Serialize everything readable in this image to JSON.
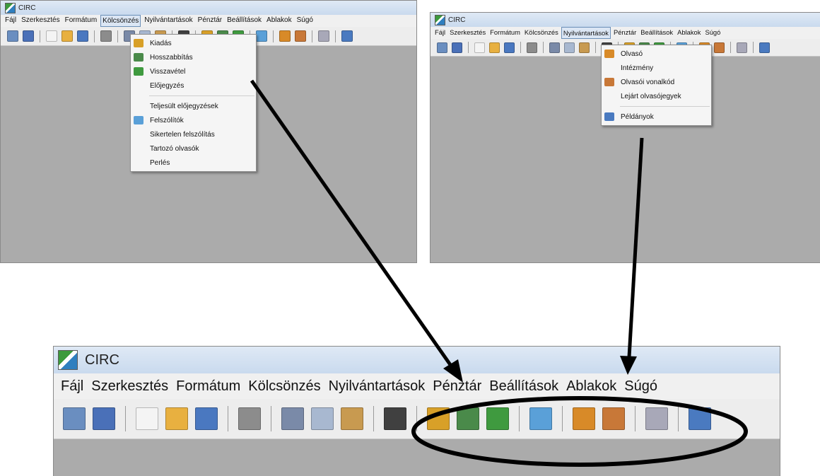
{
  "app_title": "CIRC",
  "menus": [
    "Fájl",
    "Szerkesztés",
    "Formátum",
    "Kölcsönzés",
    "Nyilvántartások",
    "Pénztár",
    "Beállítások",
    "Ablakok",
    "Súgó"
  ],
  "kolcsonzes_menu": {
    "items": [
      {
        "label": "Kiadás",
        "icon": "checkout-icon",
        "color": "#d8a028"
      },
      {
        "label": "Hosszabbítás",
        "icon": "renew-icon",
        "color": "#4a8a4a"
      },
      {
        "label": "Visszavétel",
        "icon": "return-icon",
        "color": "#3f9a3f"
      },
      {
        "label": "Előjegyzés",
        "icon": "",
        "color": ""
      },
      {
        "label": "Teljesült előjegyzések",
        "icon": "",
        "color": ""
      },
      {
        "label": "Felszólítók",
        "icon": "notice-icon",
        "color": "#5aa0d8"
      },
      {
        "label": "Sikertelen felszólítás",
        "icon": "",
        "color": ""
      },
      {
        "label": "Tartozó olvasók",
        "icon": "",
        "color": ""
      },
      {
        "label": "Perlés",
        "icon": "",
        "color": ""
      }
    ]
  },
  "nyilvantartasok_menu": {
    "items": [
      {
        "label": "Olvasó",
        "icon": "reader-icon",
        "color": "#d88a28"
      },
      {
        "label": "Intézmény",
        "icon": "",
        "color": ""
      },
      {
        "label": "Olvasói vonalkód",
        "icon": "barcode-reader-icon",
        "color": "#c87838"
      },
      {
        "label": "Lejárt olvasójegyek",
        "icon": "",
        "color": ""
      },
      {
        "label": "Példányok",
        "icon": "copies-icon",
        "color": "#4a7ac0"
      }
    ]
  },
  "toolbar_icons": [
    {
      "name": "preview-icon",
      "color": "#6a8ec0"
    },
    {
      "name": "edit-pen-icon",
      "color": "#4a70b8"
    },
    "sep",
    {
      "name": "new-document-icon",
      "color": "#f4f4f4"
    },
    {
      "name": "open-folder-icon",
      "color": "#e8b040"
    },
    {
      "name": "save-icon",
      "color": "#4a78c0"
    },
    "sep",
    {
      "name": "print-icon",
      "color": "#8c8c8c"
    },
    "sep",
    {
      "name": "cut-icon",
      "color": "#7a8aa8"
    },
    {
      "name": "copy-icon",
      "color": "#a8b8d0"
    },
    {
      "name": "paste-icon",
      "color": "#c89a50"
    },
    "sep",
    {
      "name": "find-binoculars-icon",
      "color": "#404040"
    },
    "sep",
    {
      "name": "checkout-icon",
      "color": "#d8a028"
    },
    {
      "name": "renew-icon",
      "color": "#4a8a4a"
    },
    {
      "name": "return-icon",
      "color": "#3f9a3f"
    },
    "sep",
    {
      "name": "notice-icon",
      "color": "#5aa0d8"
    },
    "sep",
    {
      "name": "reader-icon",
      "color": "#d88a28"
    },
    {
      "name": "barcode-reader-icon",
      "color": "#c87838"
    },
    "sep",
    {
      "name": "tag-icon",
      "color": "#a8a8b8"
    },
    "sep",
    {
      "name": "copies-icon",
      "color": "#4a7ac0"
    }
  ]
}
